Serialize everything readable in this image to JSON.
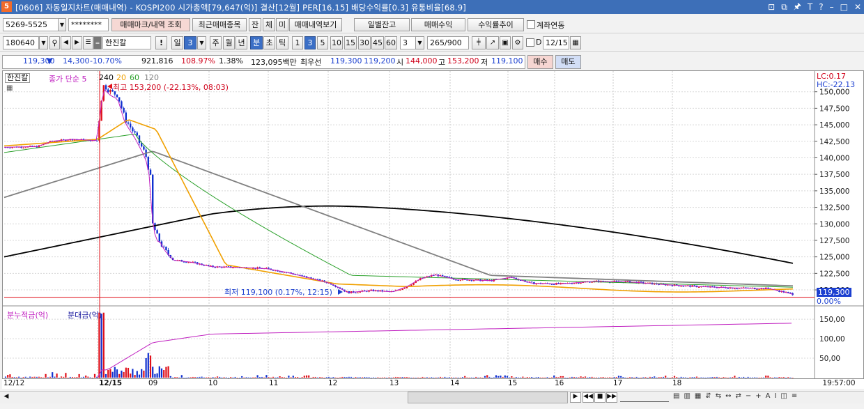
{
  "window": {
    "icon_label": "5",
    "title": "[0606] 자동일지차트(매매내역) - KOSPI200 시가총액[79,647(억)] 결산[12월] PER[16.15] 배당수익률[0.3] 유통비율[68.9]",
    "controls": [
      "⊡",
      "⧉",
      "🖈",
      "T",
      "?",
      "–",
      "□",
      "✕"
    ]
  },
  "toolbar1": {
    "account": "5269-5525",
    "password": "********",
    "buttons": [
      "매매마크/내역 조회",
      "최근매매종목",
      "잔",
      "체",
      "미",
      "매매내역보기"
    ],
    "right_buttons": [
      "일별잔고",
      "매매수익",
      "수익률추이"
    ],
    "checkbox_label": "계좌연동"
  },
  "toolbar2": {
    "code": "180640",
    "name": "한진칼",
    "period_buttons": [
      "일",
      "주",
      "월",
      "년",
      "분",
      "초",
      "틱"
    ],
    "period_value": "3",
    "min_buttons": [
      "1",
      "3",
      "5",
      "10",
      "15",
      "30",
      "45",
      "60"
    ],
    "min_select": "3",
    "count": "265",
    "count_total": "/900",
    "d_label": "D",
    "date": "12/15"
  },
  "quote": {
    "price": "119,300",
    "arrow": "▼",
    "change": "14,300",
    "change_pct": "-10.70%",
    "volume": "921,816",
    "ratio": "108.97%",
    "rate2": "1.38%",
    "amount": "123,095백만",
    "pref_label": "최우선",
    "ask": "119,300",
    "bid": "119,200",
    "open_label": "시",
    "open": "144,000",
    "high_label": "고",
    "high": "153,200",
    "low_label": "저",
    "low": "119,100",
    "buy": "매수",
    "sell": "매도"
  },
  "chart_header": {
    "stock_tag": "한진칼",
    "ma_label": "종가 단순 5",
    "ma_periods": [
      "240",
      "20",
      "60",
      "120"
    ],
    "ma_colors": [
      "#000000",
      "#f0a000",
      "#2aa02a",
      "#808080"
    ],
    "ma5_color": "#c020c0",
    "lc": "LC:0.17",
    "hc": "HC:-22.13"
  },
  "annotations": {
    "high_mark": "최고 153,200 (-22.13%, 08:03)",
    "low_mark": "최저 119,100 (0.17%, 12:15)"
  },
  "price_axis": [
    "150,000",
    "147,500",
    "145,000",
    "142,500",
    "140,000",
    "137,500",
    "135,000",
    "132,500",
    "130,000",
    "127,500",
    "125,000",
    "122,500",
    "120,000"
  ],
  "current_price_tag": "119,300",
  "current_pct_tag": "0.00%",
  "volume_header": {
    "label1": "분누적금(억)",
    "label2": "분대금(억)",
    "label1_color": "#c020c0",
    "label2_color": "#2020a0"
  },
  "volume_axis": [
    "150,00",
    "100,00",
    "50,00"
  ],
  "date_axis": [
    "12/12",
    "12/15",
    "09",
    "10",
    "11",
    "12",
    "13",
    "14",
    "15",
    "16",
    "17",
    "18"
  ],
  "time_readout": "19:57:00",
  "chart_data": {
    "type": "candlestick",
    "ylim": [
      118000,
      152500
    ],
    "y_ticks": [
      120000,
      122500,
      125000,
      127500,
      130000,
      132500,
      135000,
      137500,
      140000,
      142500,
      145000,
      147500,
      150000
    ],
    "high": 153200,
    "low": 119100,
    "last": 119300,
    "series": [
      {
        "name": "5",
        "color": "#c020c0"
      },
      {
        "name": "240",
        "color": "#000000"
      },
      {
        "name": "20",
        "color": "#f0a000"
      },
      {
        "name": "60",
        "color": "#2aa02a"
      },
      {
        "name": "120",
        "color": "#808080"
      }
    ]
  }
}
